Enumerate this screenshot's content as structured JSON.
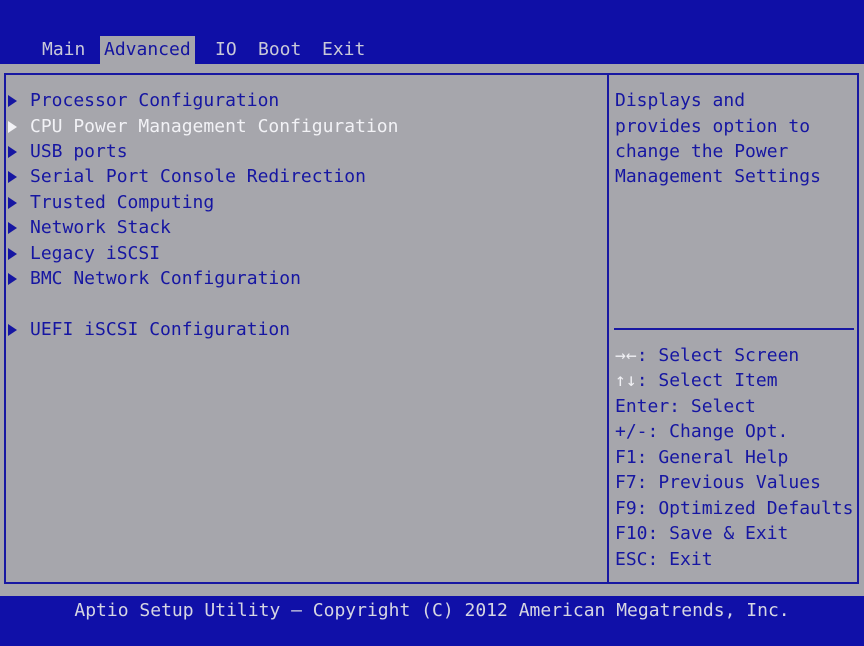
{
  "menu": {
    "tabs": [
      "Main",
      "Advanced",
      "IO",
      "Boot",
      "Exit"
    ],
    "active": "Advanced"
  },
  "items": [
    "Processor Configuration",
    "CPU Power Management Configuration",
    "USB ports",
    "Serial Port Console Redirection",
    "Trusted Computing",
    "Network Stack",
    "Legacy iSCSI",
    "BMC Network Configuration",
    "UEFI iSCSI Configuration"
  ],
  "selected_item": "CPU Power Management Configuration",
  "help": {
    "lines": [
      "Displays and",
      "provides option to",
      "change the Power",
      "Management Settings"
    ]
  },
  "keys": [
    {
      "key": "→←",
      "desc": ": Select Screen"
    },
    {
      "key": "↑↓",
      "desc": ": Select Item"
    },
    {
      "key": "",
      "desc": "Enter: Select"
    },
    {
      "key": "",
      "desc": "+/-: Change Opt."
    },
    {
      "key": "",
      "desc": "F1: General Help"
    },
    {
      "key": "",
      "desc": "F7: Previous Values"
    },
    {
      "key": "",
      "desc": "F9: Optimized Defaults"
    },
    {
      "key": "",
      "desc": "F10: Save & Exit"
    },
    {
      "key": "",
      "desc": "ESC: Exit"
    }
  ],
  "footer": "Aptio Setup Utility – Copyright (C) 2012 American Megatrends, Inc.",
  "colors": {
    "background": "#1010a8",
    "panel": "#a6a6ac",
    "text": "#1616a2",
    "highlight": "#f2f2f6"
  }
}
